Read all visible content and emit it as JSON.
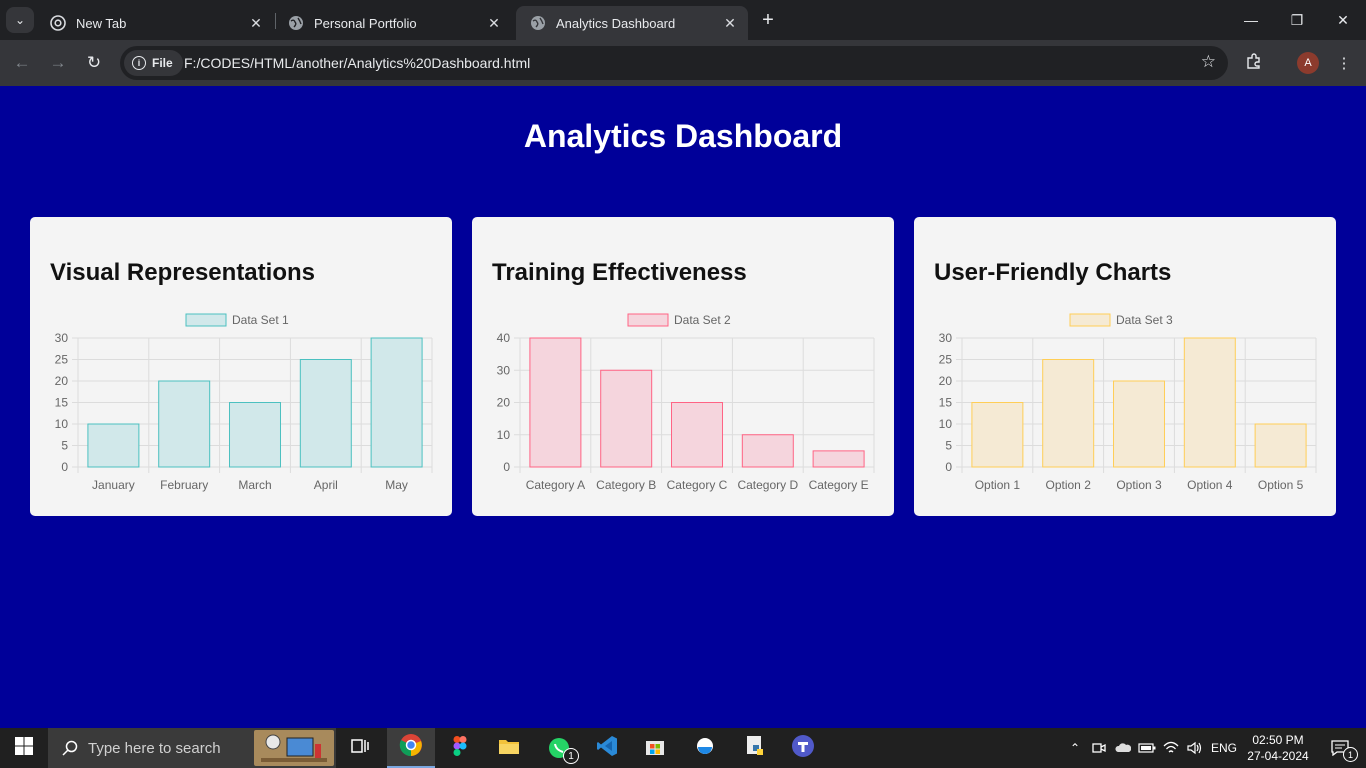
{
  "browser": {
    "tabs": [
      {
        "title": "New Tab",
        "favicon": "chrome-icon",
        "active": false
      },
      {
        "title": "Personal Portfolio",
        "favicon": "globe-icon",
        "active": false
      },
      {
        "title": "Analytics Dashboard",
        "favicon": "globe-icon",
        "active": true
      }
    ],
    "address_chip": "File",
    "url": "F:/CODES/HTML/another/Analytics%20Dashboard.html",
    "profile_initial": "A"
  },
  "page": {
    "title": "Analytics Dashboard"
  },
  "cards": [
    {
      "title": "Visual Representations",
      "chart_data": {
        "type": "bar",
        "categories": [
          "January",
          "February",
          "March",
          "April",
          "May"
        ],
        "series": [
          {
            "name": "Data Set 1",
            "values": [
              10,
              20,
              15,
              25,
              30
            ]
          }
        ],
        "ylim": [
          0,
          30
        ],
        "yticks": [
          0,
          5,
          10,
          15,
          20,
          25,
          30
        ],
        "fill": "#d1e8ea",
        "stroke": "#4bc0c0",
        "grid": true,
        "legend": "top-center"
      }
    },
    {
      "title": "Training Effectiveness",
      "chart_data": {
        "type": "bar",
        "categories": [
          "Category A",
          "Category B",
          "Category C",
          "Category D",
          "Category E"
        ],
        "series": [
          {
            "name": "Data Set 2",
            "values": [
              40,
              30,
              20,
              10,
              5
            ]
          }
        ],
        "ylim": [
          0,
          40
        ],
        "yticks": [
          0,
          10,
          20,
          30,
          40
        ],
        "fill": "#f5d5dd",
        "stroke": "#ff6384",
        "grid": true,
        "legend": "top-center"
      }
    },
    {
      "title": "User-Friendly Charts",
      "chart_data": {
        "type": "bar",
        "categories": [
          "Option 1",
          "Option 2",
          "Option 3",
          "Option 4",
          "Option 5"
        ],
        "series": [
          {
            "name": "Data Set 3",
            "values": [
              15,
              25,
              20,
              30,
              10
            ]
          }
        ],
        "ylim": [
          0,
          30
        ],
        "yticks": [
          0,
          5,
          10,
          15,
          20,
          25,
          30
        ],
        "fill": "#f5ead4",
        "stroke": "#ffce56",
        "grid": true,
        "legend": "top-center"
      }
    }
  ],
  "taskbar": {
    "search_placeholder": "Type here to search",
    "language": "ENG",
    "time": "02:50 PM",
    "date": "27-04-2024",
    "whatsapp_badge": "1",
    "notification_badge": "1"
  }
}
